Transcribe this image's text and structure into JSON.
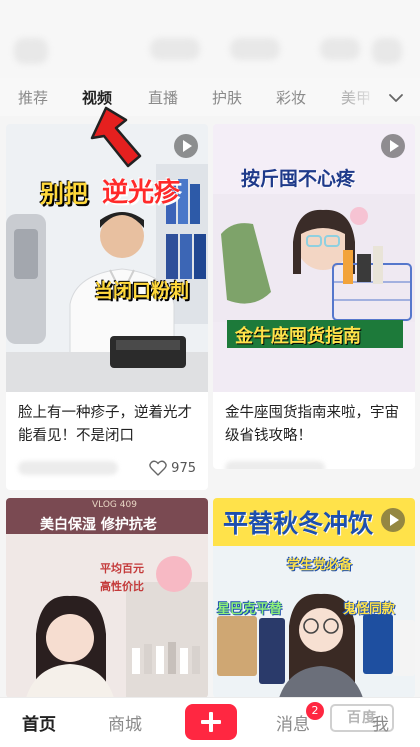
{
  "tabs": {
    "items": [
      "推荐",
      "视频",
      "直播",
      "护肤",
      "彩妆",
      "美甲"
    ],
    "active": "视频"
  },
  "feed": {
    "cards": [
      {
        "title": "脸上有一种疹子，逆着光才能看见！不是闭口",
        "likes": "975",
        "overlay": {
          "line1a": "别把",
          "line1b": "逆光疹",
          "line2": "当闭口粉刺"
        }
      },
      {
        "title": "金牛座囤货指南来啦，宇宙级省钱攻略！",
        "overlay": {
          "top": "按斤囤不心疼",
          "bottom": "金牛座囤货指南"
        }
      },
      {
        "overlay": {
          "vlog": "VLOG 409",
          "banner": "美白保湿 修护抗老",
          "note1": "平均百元",
          "note2": "高性价比"
        }
      },
      {
        "overlay": {
          "banner": "平替秋冬冲饮",
          "note1": "学生党必备",
          "note2": "星巴克平替",
          "note3": "鬼怪同款"
        }
      }
    ]
  },
  "bottom_nav": {
    "home": "首页",
    "mall": "商城",
    "messages": "消息",
    "me": "我",
    "messages_badge": "2"
  },
  "watermark": "百度",
  "colors": {
    "accent": "#ff2741",
    "arrow": "#e5201f",
    "active_tab": "#222222",
    "inactive": "#8a8a8a"
  }
}
